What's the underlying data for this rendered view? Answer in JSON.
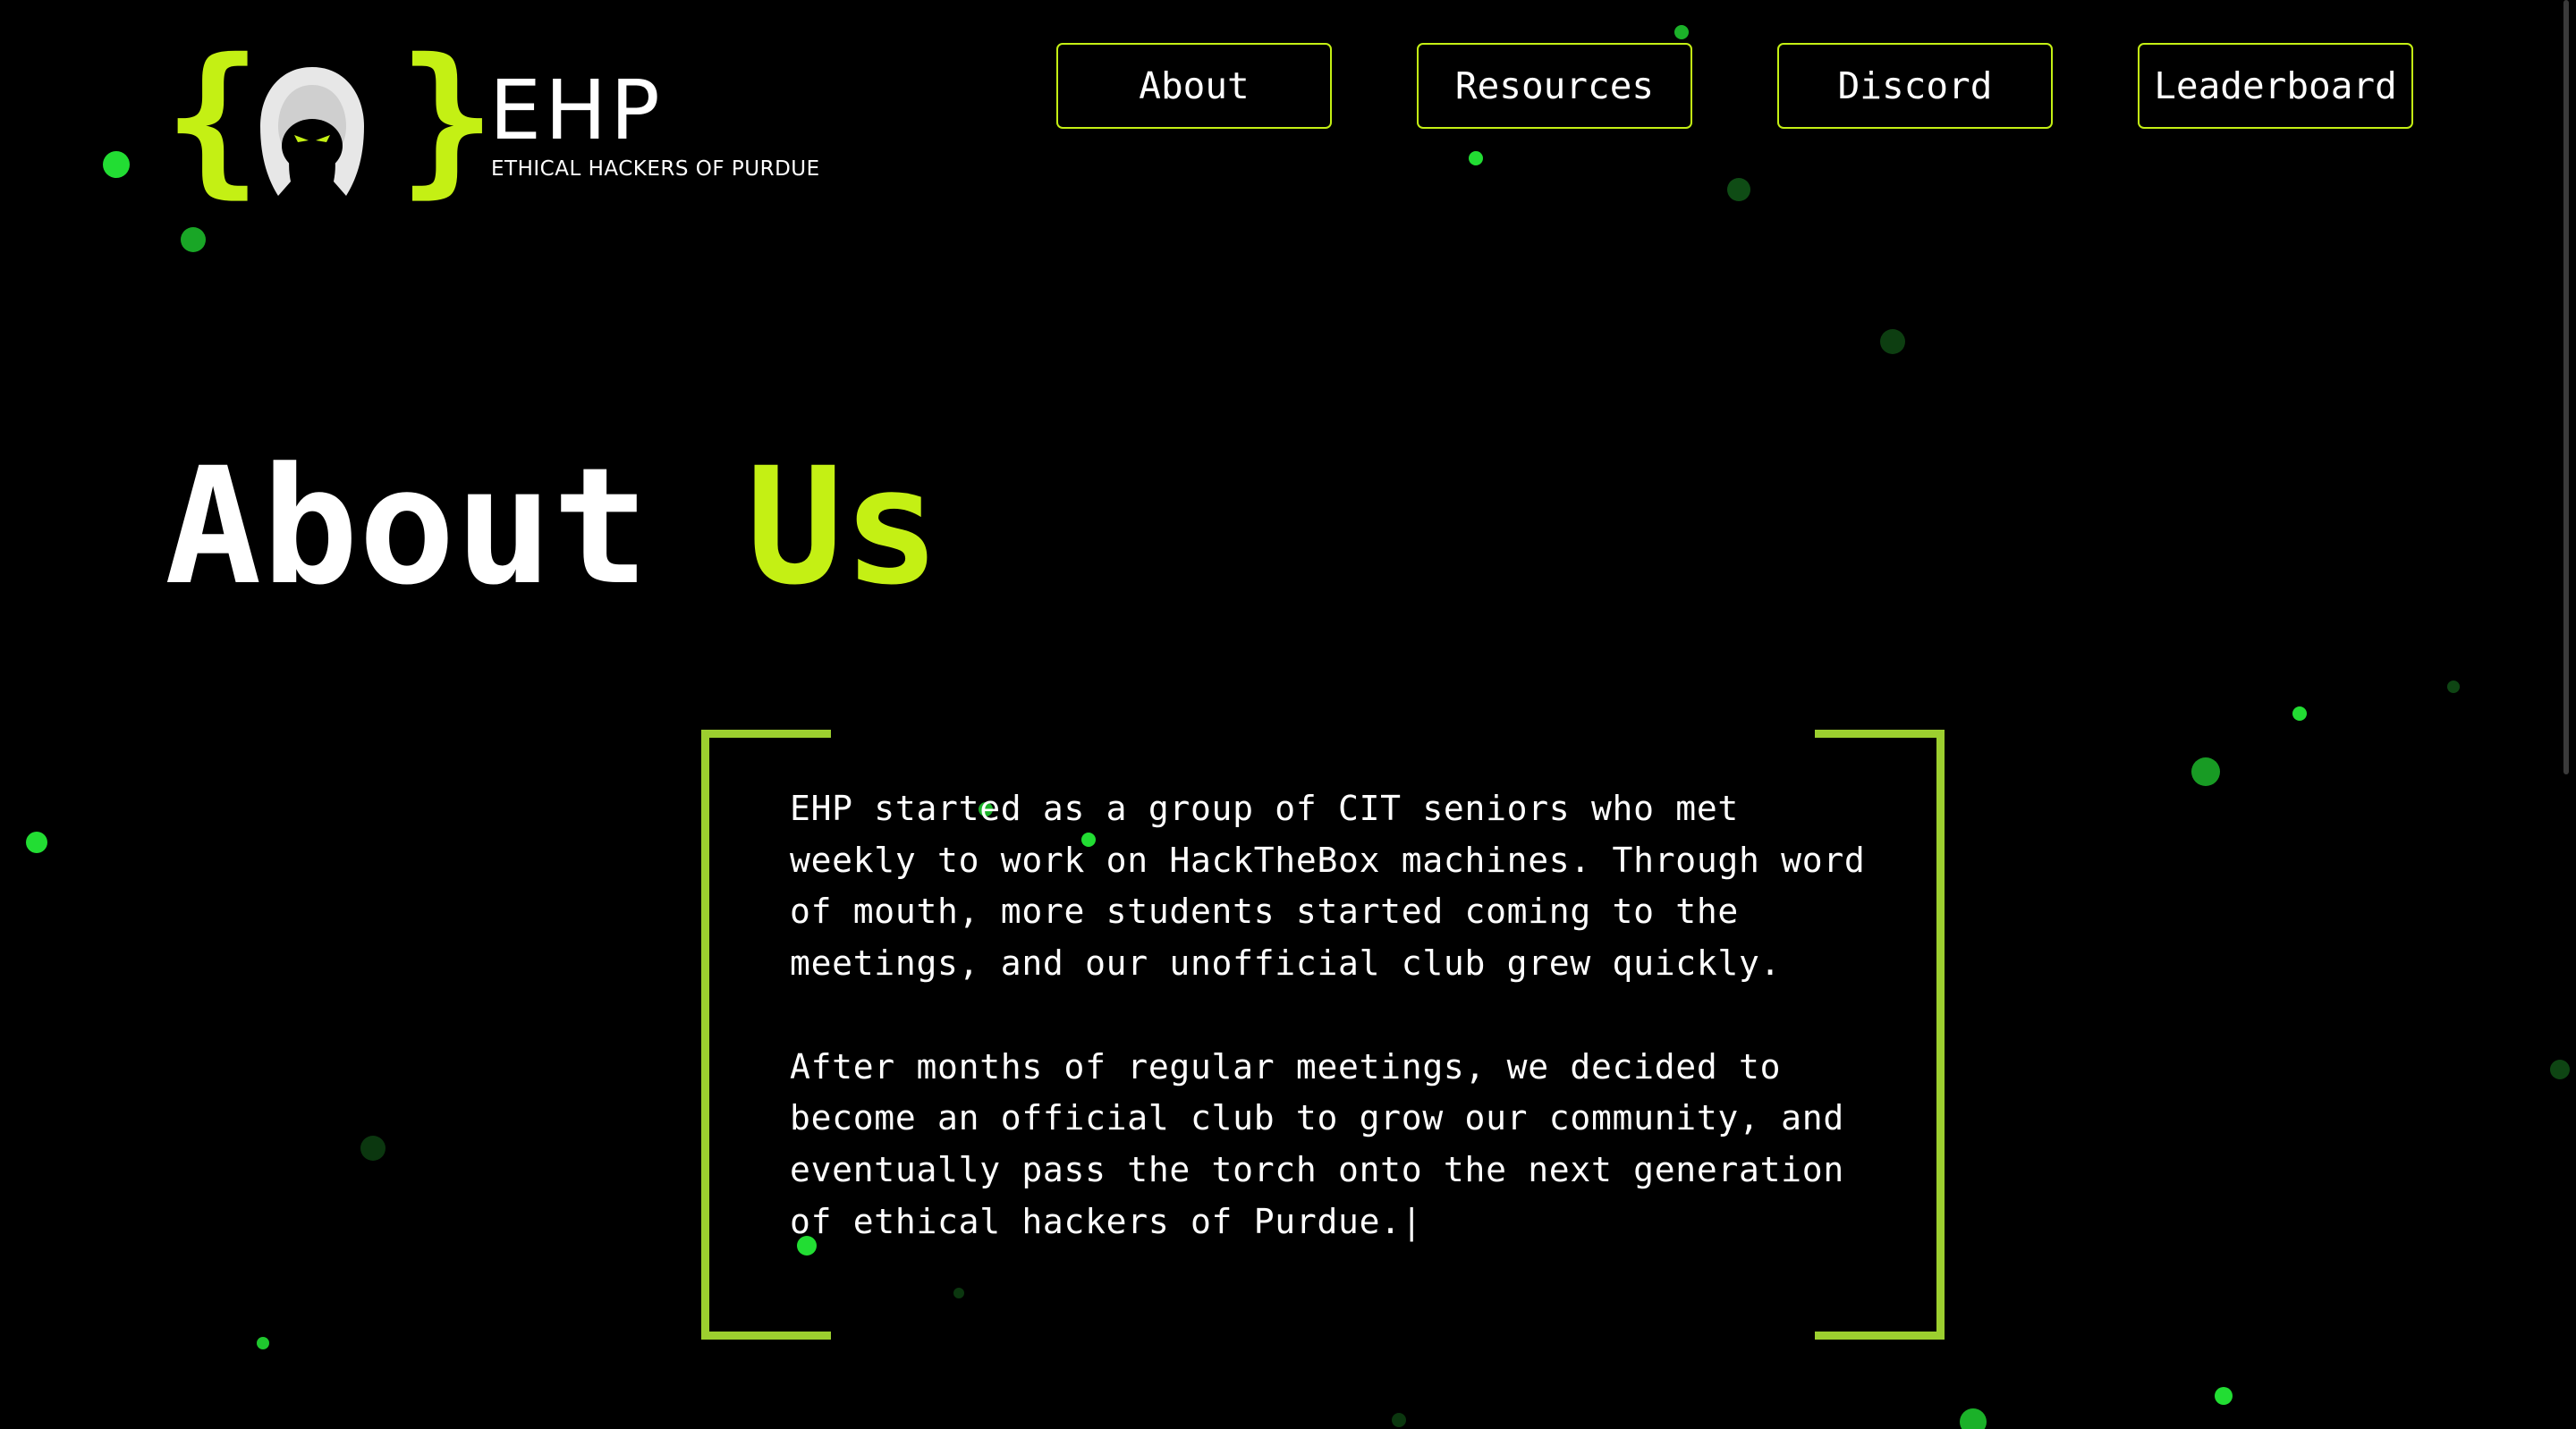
{
  "brand": {
    "name": "EHP",
    "tagline": "ETHICAL HACKERS OF PURDUE",
    "brace_open": "{",
    "brace_close": "}",
    "mascot_icon": "hooded-hacker-icon",
    "accent_color": "#c4f014"
  },
  "nav": {
    "items": [
      {
        "label": "About"
      },
      {
        "label": "Resources"
      },
      {
        "label": "Discord"
      },
      {
        "label": "Leaderboard"
      }
    ]
  },
  "hero": {
    "title_main": "About ",
    "title_accent": "Us"
  },
  "about": {
    "paragraphs": [
      "EHP started as a group of CIT seniors who met weekly to work on HackTheBox machines. Through word of mouth, more students started coming to the meetings, and our unofficial club grew quickly.",
      "After months of regular meetings, we decided to become an official club to grow our community, and eventually pass the torch onto the next generation of ethical hackers of Purdue."
    ],
    "cursor": "|"
  },
  "theme": {
    "background": "#000000",
    "text": "#ffffff",
    "accent": "#c4f014",
    "bracket": "#9ccf2f",
    "particle": "#22dd33"
  }
}
